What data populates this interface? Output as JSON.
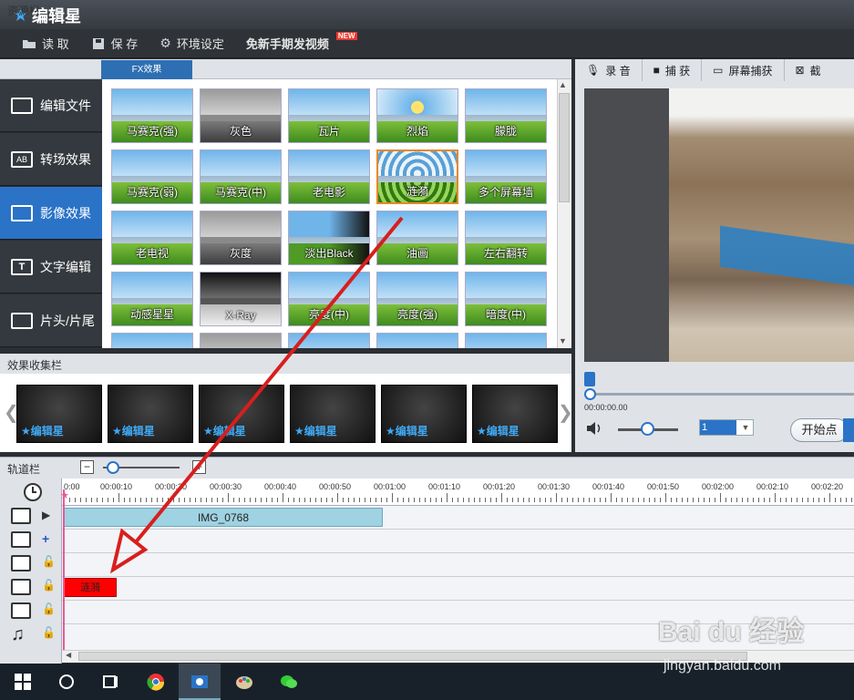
{
  "app": {
    "title": "编辑星"
  },
  "menu": {
    "open": "读 取",
    "save": "保 存",
    "settings": "环境设定",
    "video": "免新手期发视频",
    "new_badge": "NEW"
  },
  "resources": {
    "header": "资源栏",
    "tab": "FX效果",
    "sidebar": [
      {
        "label": "编辑文件",
        "active": false
      },
      {
        "label": "转场效果",
        "active": false
      },
      {
        "label": "影像效果",
        "active": true
      },
      {
        "label": "文字编辑",
        "active": false
      },
      {
        "label": "片头/片尾",
        "active": false
      }
    ],
    "effects": [
      [
        "马赛克(强)",
        "灰色",
        "瓦片",
        "烈焰",
        "朦胧"
      ],
      [
        "马赛克(弱)",
        "马赛克(中)",
        "老电影",
        "涟漪",
        "多个屏幕墙"
      ],
      [
        "老电视",
        "灰度",
        "淡出Black",
        "油画",
        "左右翻转"
      ],
      [
        "动感星星",
        "X-Ray",
        "亮度(中)",
        "亮度(强)",
        "暗度(中)"
      ]
    ],
    "selected_effect": "涟漪"
  },
  "collection": {
    "header": "效果收集栏",
    "item_label": "编辑星",
    "count": 6
  },
  "preview": {
    "tools": [
      "录 音",
      "捕 获",
      "屏幕捕获",
      "截"
    ],
    "timecode": "00:00:00.00",
    "speed": "1",
    "start_button": "开始点"
  },
  "tracks": {
    "header": "轨道栏",
    "ruler": [
      "0:00",
      "00:00:10",
      "00:00:20",
      "00:00:30",
      "00:00:40",
      "00:00:50",
      "00:01:00",
      "00:01:10",
      "00:01:20",
      "00:01:30",
      "00:01:40",
      "00:01:50",
      "00:02:00",
      "00:02:10",
      "00:02:20"
    ],
    "video_clip": "IMG_0768",
    "fx_clip": "涟漪"
  },
  "watermark": {
    "logo": "Bai du 经验",
    "url": "jingyan.baidu.com"
  },
  "colors": {
    "accent": "#2b73c7",
    "arrow": "#d81e1e",
    "fx_clip": "#ff0000",
    "video_clip": "#9fd2e2"
  }
}
